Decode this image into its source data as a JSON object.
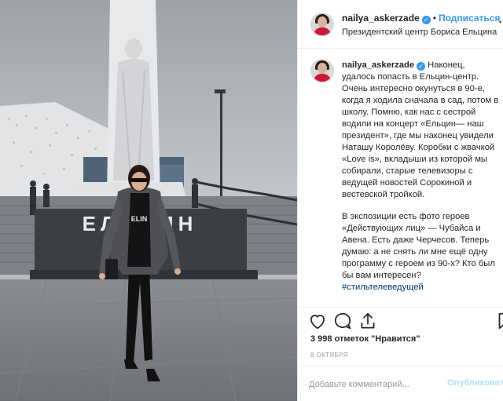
{
  "header": {
    "username": "nailya_askerzade",
    "verified_mark": "✓",
    "separator": "•",
    "follow_label": "Подписаться",
    "location": "Президентский центр Бориса Ельцина",
    "more_label": "…"
  },
  "caption": {
    "username": "nailya_askerzade",
    "verified_mark": "✓",
    "paragraph1": "Наконец, удалось попасть в Ельцин-центр. Очень интересно окунуться в 90-е, когда я ходила сначала в сад, потом в школу. Помню, как нас с сестрой водили на концерт «Ельцин— наш президент», где мы наконец увидели Наташу Королёву. Коробки с жвачкой «Love is», вкладыши из которой мы собирали, старые телевизоры с ведущей новостей Сорокиной и вестевской тройкой.",
    "paragraph2": "В экспозиции есть фото героев «Действующих лиц» — Чубайса и Авена. Есть даже Черчесов. Теперь думаю: а не снять ли мне ещё одну программу с героем из 90-х? Кто был бы вам интересен?",
    "hashtag": "#стильтелеведущей"
  },
  "photo": {
    "sign_text": "ЕЛЬЦИН",
    "shirt_text": "ELIN"
  },
  "actions": {
    "icons": [
      "heart-icon",
      "comment-icon",
      "share-icon",
      "bookmark-icon"
    ],
    "likes_text": "3 998 отметок \"Нравится\"",
    "date_text": "8 октября",
    "comment_placeholder": "Добавьте комментарий...",
    "publish_label": "Опубликовать"
  },
  "colors": {
    "link_blue": "#3897f0",
    "hashtag": "#003569",
    "publish_disabled": "#b2dffc",
    "muted": "#999999"
  }
}
